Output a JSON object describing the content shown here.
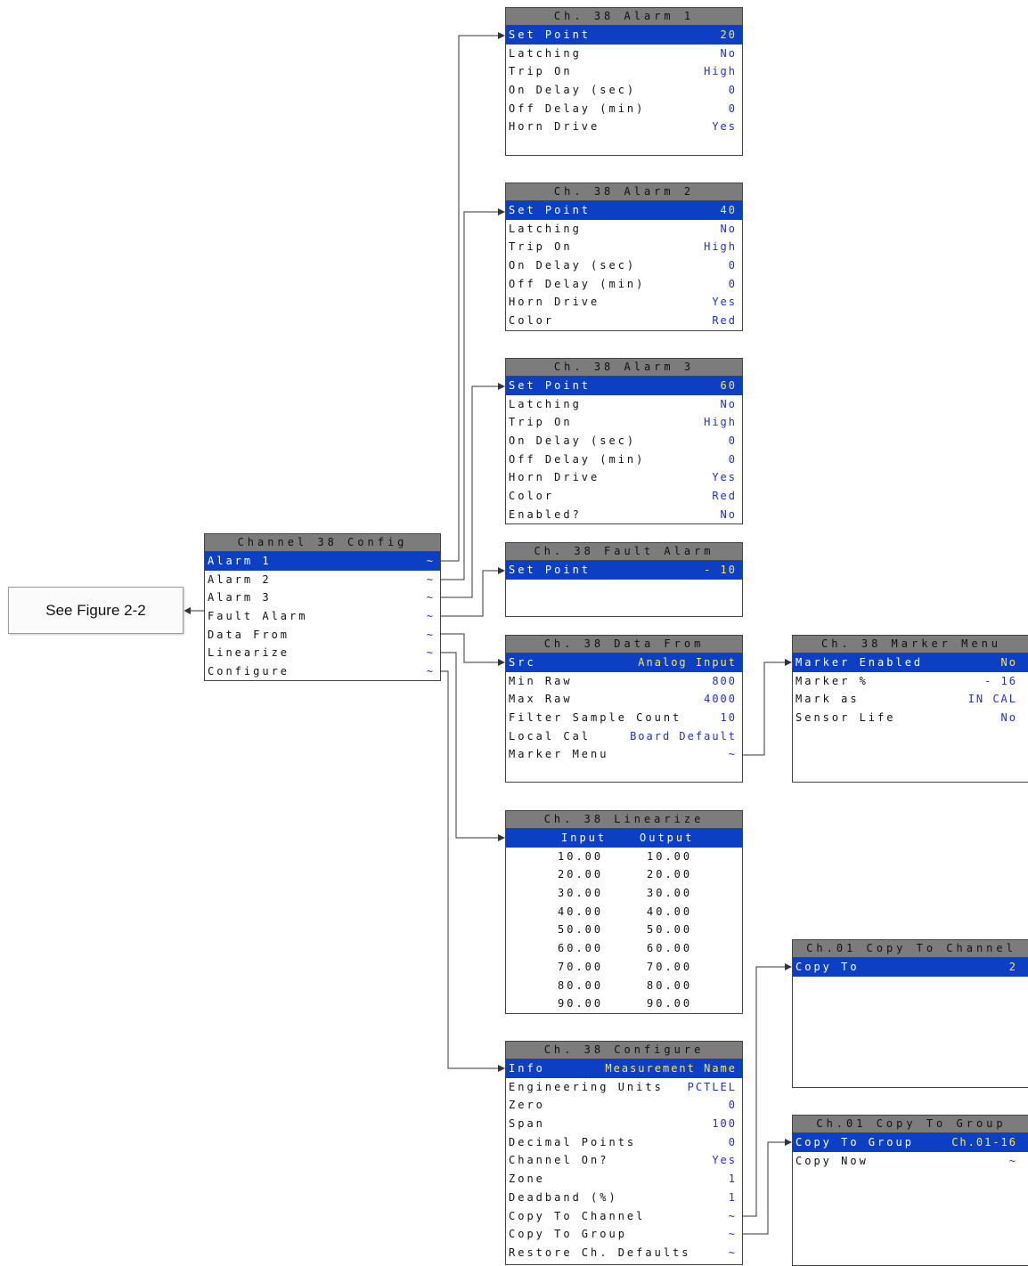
{
  "see_figure": "See Figure 2-2",
  "channel_config": {
    "title": "Channel 38 Config",
    "items": [
      {
        "label": "Alarm 1",
        "value": "~"
      },
      {
        "label": "Alarm 2",
        "value": "~"
      },
      {
        "label": "Alarm 3",
        "value": "~"
      },
      {
        "label": "Fault Alarm",
        "value": "~"
      },
      {
        "label": "Data From",
        "value": "~"
      },
      {
        "label": "Linearize",
        "value": "~"
      },
      {
        "label": "Configure",
        "value": "~"
      }
    ]
  },
  "alarm1": {
    "title": "Ch. 38 Alarm 1",
    "rows": [
      {
        "label": "Set Point",
        "value": "20"
      },
      {
        "label": "Latching",
        "value": "No"
      },
      {
        "label": "Trip On",
        "value": "High"
      },
      {
        "label": "On Delay (sec)",
        "value": "0"
      },
      {
        "label": "Off Delay (min)",
        "value": "0"
      },
      {
        "label": "Horn Drive",
        "value": "Yes"
      }
    ]
  },
  "alarm2": {
    "title": "Ch. 38 Alarm 2",
    "rows": [
      {
        "label": "Set Point",
        "value": "40"
      },
      {
        "label": "Latching",
        "value": "No"
      },
      {
        "label": "Trip On",
        "value": "High"
      },
      {
        "label": "On Delay (sec)",
        "value": "0"
      },
      {
        "label": "Off Delay (min)",
        "value": "0"
      },
      {
        "label": "Horn Drive",
        "value": "Yes"
      },
      {
        "label": "Color",
        "value": "Red"
      }
    ]
  },
  "alarm3": {
    "title": "Ch. 38 Alarm 3",
    "rows": [
      {
        "label": "Set Point",
        "value": "60"
      },
      {
        "label": "Latching",
        "value": "No"
      },
      {
        "label": "Trip On",
        "value": "High"
      },
      {
        "label": "On Delay (sec)",
        "value": "0"
      },
      {
        "label": "Off Delay (min)",
        "value": "0"
      },
      {
        "label": "Horn Drive",
        "value": "Yes"
      },
      {
        "label": "Color",
        "value": "Red"
      },
      {
        "label": "Enabled?",
        "value": "No"
      }
    ]
  },
  "fault_alarm": {
    "title": "Ch. 38 Fault Alarm",
    "rows": [
      {
        "label": "Set Point",
        "value": "- 10"
      }
    ]
  },
  "data_from": {
    "title": "Ch. 38 Data From",
    "rows": [
      {
        "label": "Src",
        "value": "Analog Input"
      },
      {
        "label": "Min Raw",
        "value": "800"
      },
      {
        "label": "Max Raw",
        "value": "4000"
      },
      {
        "label": "Filter Sample Count",
        "value": "10"
      },
      {
        "label": "Local Cal",
        "value": "Board Default"
      },
      {
        "label": "Marker Menu",
        "value": "~"
      }
    ]
  },
  "marker_menu": {
    "title": "Ch. 38 Marker Menu",
    "rows": [
      {
        "label": "Marker Enabled",
        "value": "No"
      },
      {
        "label": "Marker %",
        "value": "- 16"
      },
      {
        "label": "Mark as",
        "value": "IN CAL"
      },
      {
        "label": "Sensor Life",
        "value": "No"
      }
    ]
  },
  "linearize": {
    "title": "Ch. 38 Linearize",
    "header": {
      "input": "Input",
      "output": "Output"
    },
    "rows": [
      {
        "input": "10.00",
        "output": "10.00"
      },
      {
        "input": "20.00",
        "output": "20.00"
      },
      {
        "input": "30.00",
        "output": "30.00"
      },
      {
        "input": "40.00",
        "output": "40.00"
      },
      {
        "input": "50.00",
        "output": "50.00"
      },
      {
        "input": "60.00",
        "output": "60.00"
      },
      {
        "input": "70.00",
        "output": "70.00"
      },
      {
        "input": "80.00",
        "output": "80.00"
      },
      {
        "input": "90.00",
        "output": "90.00"
      }
    ]
  },
  "configure": {
    "title": "Ch. 38 Configure",
    "info_label": "Info",
    "info_value": "Measurement Name",
    "units_label": "Engineering Units",
    "units_value": "PCTLEL",
    "rows": [
      {
        "label": "Zero",
        "value": "0"
      },
      {
        "label": "Span",
        "value": "100"
      },
      {
        "label": "Decimal Points",
        "value": "0"
      },
      {
        "label": "Channel On?",
        "value": "Yes"
      },
      {
        "label": "Zone",
        "value": "1"
      },
      {
        "label": "Deadband (%)",
        "value": "1"
      },
      {
        "label": "Copy To Channel",
        "value": "~"
      },
      {
        "label": "Copy To Group",
        "value": "~"
      },
      {
        "label": "Restore Ch. Defaults",
        "value": "~"
      }
    ]
  },
  "copy_channel": {
    "title": "Ch.01 Copy To Channel",
    "rows": [
      {
        "label": "Copy To",
        "value": "2"
      }
    ]
  },
  "copy_group": {
    "title": "Ch.01 Copy To Group",
    "rows": [
      {
        "label": "Copy To Group",
        "value": "Ch.01-16"
      },
      {
        "label": "Copy Now",
        "value": "~"
      }
    ]
  }
}
